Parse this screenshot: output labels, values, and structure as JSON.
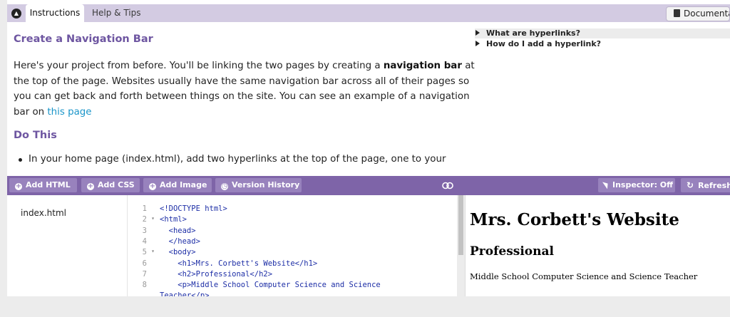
{
  "tabs": [
    {
      "label": "Instructions",
      "active": true
    },
    {
      "label": "Help & Tips",
      "active": false
    }
  ],
  "documentation_button": "Documenta",
  "instructions": {
    "title": "Create a Navigation Bar",
    "paragraph": {
      "text1": "Here's your project from before. You'll be linking the two pages by creating a ",
      "bold": "navigation bar",
      "text2": " at the top of the page. Websites usually have the same navigation bar across all of their pages so you can get back and forth between things on the site. You can see an example of a navigation bar on ",
      "link": "this page"
    },
    "do_this_heading": "Do This",
    "bullet": "In your home page (index.html), add two hyperlinks at the top of the page, one to your"
  },
  "faq": [
    "What are hyperlinks?",
    "How do I add a hyperlink?"
  ],
  "toolbar": {
    "add_html": "Add HTML",
    "add_css": "Add CSS",
    "add_image": "Add Image",
    "version_history": "Version History",
    "inspector": "Inspector: Off",
    "refresh": "Refresh"
  },
  "files": [
    "index.html"
  ],
  "code_lines": [
    {
      "n": "1",
      "fold": "",
      "text": "<!DOCTYPE html>"
    },
    {
      "n": "2",
      "fold": "▾",
      "text": "<html>"
    },
    {
      "n": "3",
      "fold": "",
      "text": "  <head>"
    },
    {
      "n": "4",
      "fold": "",
      "text": "  </head>"
    },
    {
      "n": "5",
      "fold": "▾",
      "text": "  <body>"
    },
    {
      "n": "6",
      "fold": "",
      "text": "    <h1>Mrs. Corbett's Website</h1>"
    },
    {
      "n": "7",
      "fold": "",
      "text": "    <h2>Professional</h2>"
    },
    {
      "n": "8",
      "fold": "",
      "text": "    <p>Middle School Computer Science and Science"
    },
    {
      "n": "",
      "fold": "",
      "text": "Teacher</p>"
    }
  ],
  "preview": {
    "h1": "Mrs. Corbett's Website",
    "h2": "Professional",
    "p": "Middle School Computer Science and Science Teacher"
  }
}
